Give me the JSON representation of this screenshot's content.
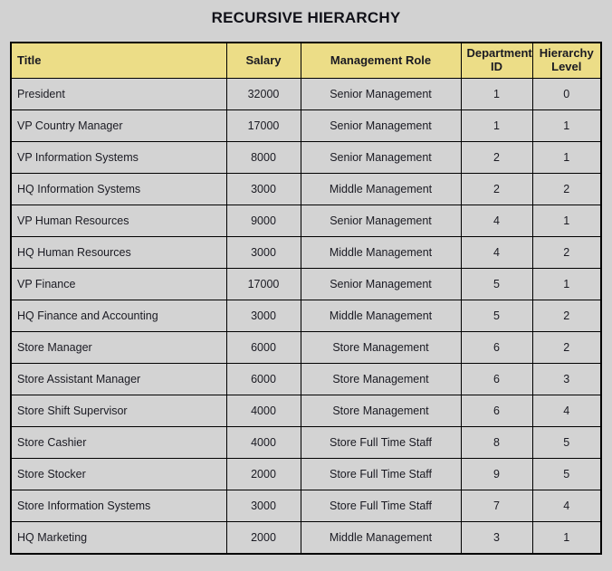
{
  "report": {
    "title": "RECURSIVE HIERARCHY"
  },
  "colors": {
    "page_background": "#d2d2d2",
    "header_fill": "#ecdd87",
    "body_fill": "#d3d3d3",
    "hierarchy_level_fill": "#ffc0c0",
    "border": "#000000",
    "text": "#1a1a22"
  },
  "table": {
    "columns": [
      {
        "key": "title",
        "label": "Title",
        "align": "left"
      },
      {
        "key": "salary",
        "label": "Salary",
        "align": "center"
      },
      {
        "key": "role",
        "label": "Management Role",
        "align": "center"
      },
      {
        "key": "dept_id",
        "label": "Department ID",
        "align": "center"
      },
      {
        "key": "hierarchy_level",
        "label": "Hierarchy Level",
        "align": "center"
      }
    ],
    "rows": [
      {
        "title": "President",
        "salary": "32000",
        "role": "Senior Management",
        "dept_id": "1",
        "hierarchy_level": "0"
      },
      {
        "title": "VP Country Manager",
        "salary": "17000",
        "role": "Senior Management",
        "dept_id": "1",
        "hierarchy_level": "1"
      },
      {
        "title": "VP Information Systems",
        "salary": "8000",
        "role": "Senior Management",
        "dept_id": "2",
        "hierarchy_level": "1"
      },
      {
        "title": "HQ Information Systems",
        "salary": "3000",
        "role": "Middle Management",
        "dept_id": "2",
        "hierarchy_level": "2"
      },
      {
        "title": "VP Human Resources",
        "salary": "9000",
        "role": "Senior Management",
        "dept_id": "4",
        "hierarchy_level": "1"
      },
      {
        "title": "HQ Human Resources",
        "salary": "3000",
        "role": "Middle Management",
        "dept_id": "4",
        "hierarchy_level": "2"
      },
      {
        "title": "VP Finance",
        "salary": "17000",
        "role": "Senior Management",
        "dept_id": "5",
        "hierarchy_level": "1"
      },
      {
        "title": "HQ Finance and Accounting",
        "salary": "3000",
        "role": "Middle Management",
        "dept_id": "5",
        "hierarchy_level": "2"
      },
      {
        "title": "Store Manager",
        "salary": "6000",
        "role": "Store Management",
        "dept_id": "6",
        "hierarchy_level": "2"
      },
      {
        "title": "Store Assistant Manager",
        "salary": "6000",
        "role": "Store Management",
        "dept_id": "6",
        "hierarchy_level": "3"
      },
      {
        "title": "Store Shift Supervisor",
        "salary": "4000",
        "role": "Store Management",
        "dept_id": "6",
        "hierarchy_level": "4"
      },
      {
        "title": "Store Cashier",
        "salary": "4000",
        "role": "Store Full Time Staff",
        "dept_id": "8",
        "hierarchy_level": "5"
      },
      {
        "title": "Store Stocker",
        "salary": "2000",
        "role": "Store Full Time Staff",
        "dept_id": "9",
        "hierarchy_level": "5"
      },
      {
        "title": "Store Information Systems",
        "salary": "3000",
        "role": "Store Full Time Staff",
        "dept_id": "7",
        "hierarchy_level": "4"
      },
      {
        "title": "HQ Marketing",
        "salary": "2000",
        "role": "Middle Management",
        "dept_id": "3",
        "hierarchy_level": "1"
      }
    ]
  }
}
